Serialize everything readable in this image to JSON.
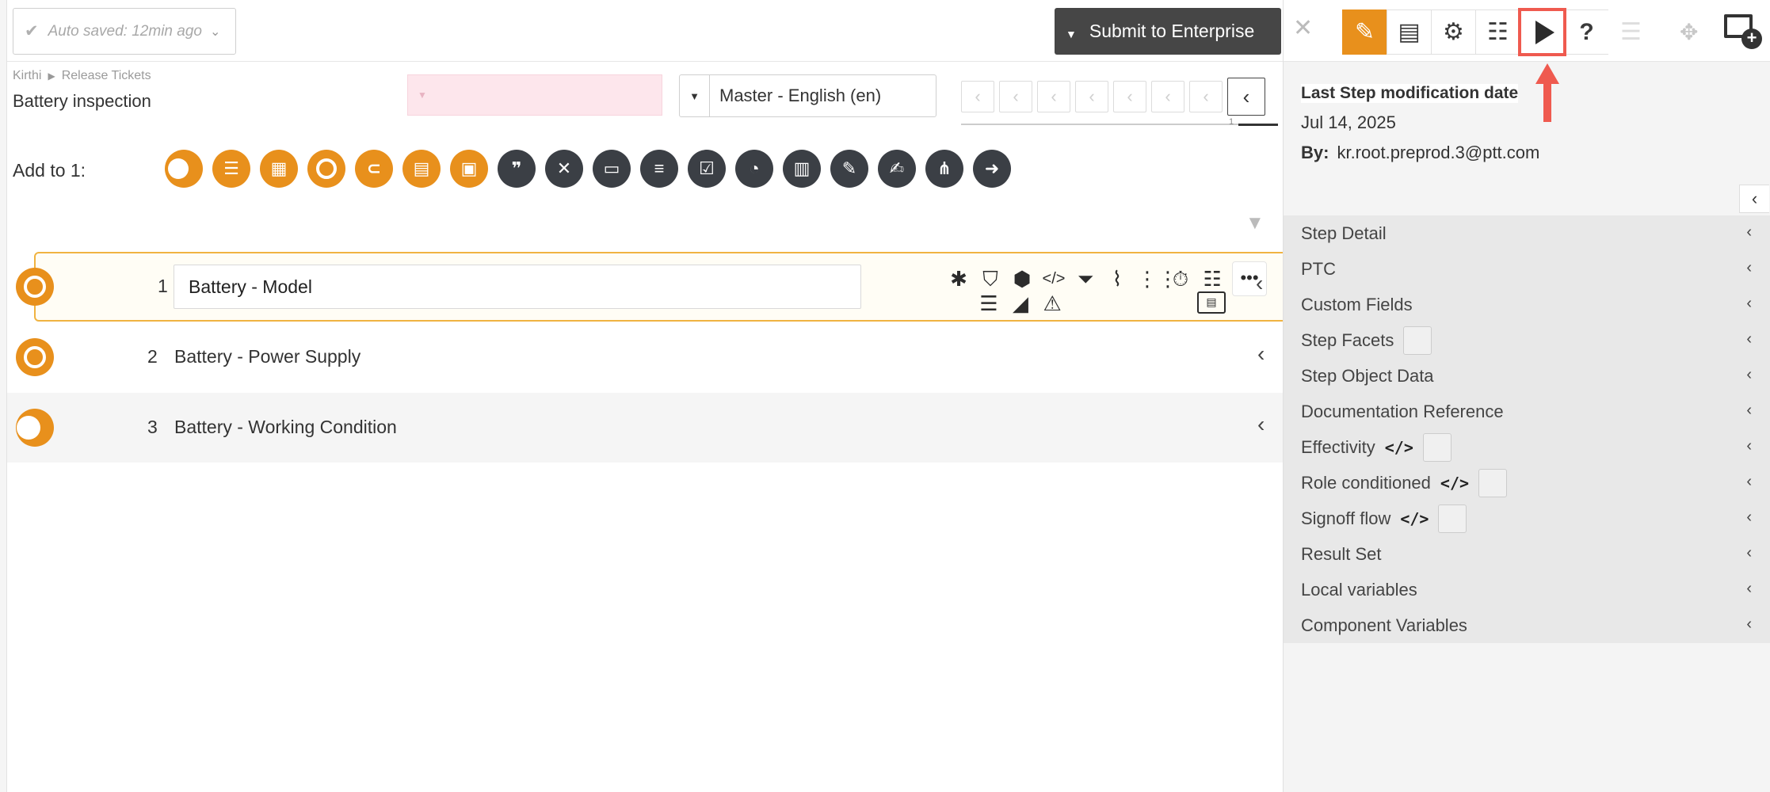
{
  "toolbar": {
    "autosave": "Auto saved: 12min ago",
    "submit": "Submit to Enterprise"
  },
  "breadcrumb": {
    "parent": "Kirthi",
    "child": "Release Tickets"
  },
  "page_title": "Battery inspection",
  "language": "Master - English (en)",
  "pager": {
    "current": "1"
  },
  "add_to": {
    "label": "Add to 1:",
    "icons": [
      "half-circle-icon",
      "numbered-list-icon",
      "table-icon",
      "ring-icon",
      "attachment-icon",
      "checklist-icon",
      "film-icon",
      "quote-icon",
      "cross-check-icon",
      "input-field-icon",
      "task-list-icon",
      "checkbox-icon",
      "clock-icon",
      "calculator-icon",
      "ruler-pencil-icon",
      "signature-icon",
      "share-icon",
      "arrow-right-icon"
    ]
  },
  "steps": [
    {
      "number": "1",
      "title": "Battery - Model"
    },
    {
      "number": "2",
      "title": "Battery - Power Supply"
    },
    {
      "number": "3",
      "title": "Battery - Working Condition"
    }
  ],
  "right_panel": {
    "tools": [
      "pencil-icon",
      "clipboard-icon",
      "gear-icon",
      "checklist-icon",
      "play-icon",
      "help-icon",
      "list-icon"
    ],
    "mod_title": "Last Step modification date",
    "mod_date": "Jul 14, 2025",
    "by_label": "By:",
    "by_value": "kr.root.preprod.3@ptt.com",
    "sections": [
      {
        "label": "Step Detail"
      },
      {
        "label": "PTC"
      },
      {
        "label": "Custom Fields"
      },
      {
        "label": "Step Facets"
      },
      {
        "label": "Step Object Data"
      },
      {
        "label": "Documentation Reference"
      },
      {
        "label": "Effectivity",
        "code": "</>"
      },
      {
        "label": "Role conditioned",
        "code": "</>"
      },
      {
        "label": "Signoff flow",
        "code": "</>"
      },
      {
        "label": "Result Set"
      },
      {
        "label": "Local variables"
      },
      {
        "label": "Component Variables"
      }
    ]
  },
  "colors": {
    "accent": "#e8901c",
    "dark": "#3b3f45",
    "highlight": "#ef5a4f"
  }
}
